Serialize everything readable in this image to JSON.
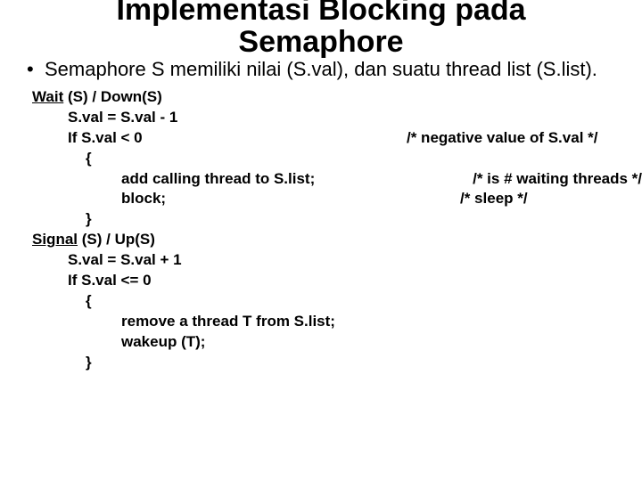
{
  "title_line1": "Implementasi Blocking pada",
  "title_line2": "Semaphore",
  "bullet_text": "Semaphore S memiliki nilai (S.val), dan suatu thread list (S.list).",
  "wait_hdr_u": "Wait",
  "wait_hdr_rest": " (S) / Down(S)",
  "wait_l1": "S.val = S.val - 1",
  "wait_l2_left": "If S.val < 0",
  "wait_l2_right": "/* negative value of S.val */",
  "brace_open": "{",
  "wait_l3_left": "add calling thread to S.list;",
  "wait_l3_right": "/* is # waiting threads */",
  "wait_l4_left": "block;",
  "wait_l4_right": "/* sleep */",
  "brace_close": "}",
  "sig_hdr_u": "Signal",
  "sig_hdr_rest": " (S) / Up(S)",
  "sig_l1": "S.val = S.val + 1",
  "sig_l2": "If S.val <= 0",
  "sig_l3": "remove a thread T from S.list;",
  "sig_l4": "wakeup (T);"
}
